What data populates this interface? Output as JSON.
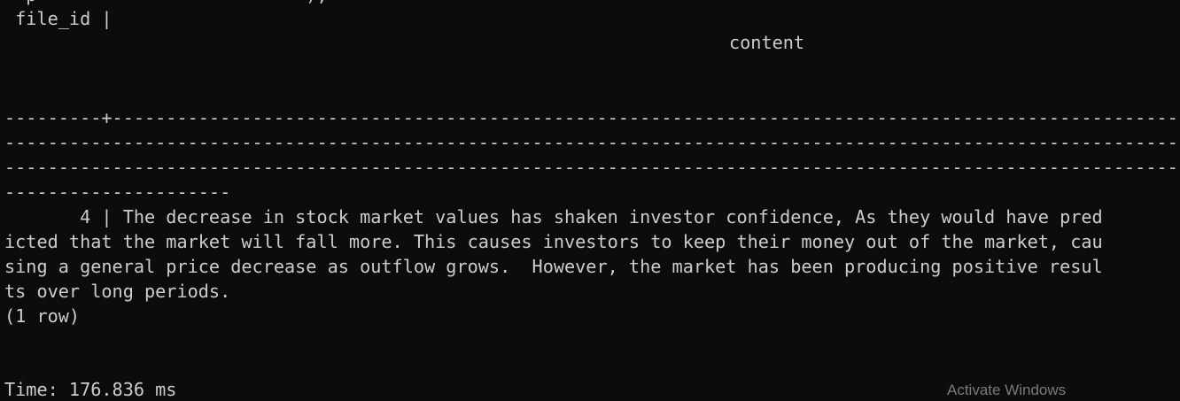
{
  "terminal": {
    "top_cut_line": "  p                         ),",
    "header_file_id": " file_id |",
    "header_content": "content",
    "separator_lines": [
      "---------+------------------------------------------------------------------------------------------------------------------------",
      "----------------------------------------------------------------------------------------------------------------------------------",
      "----------------------------------------------------------------------------------------------------------------------------------",
      "---------------------"
    ],
    "row_lines": [
      "       4 | The decrease in stock market values has shaken investor confidence, As they would have pred",
      "icted that the market will fall more. This causes investors to keep their money out of the market, cau",
      "sing a general price decrease as outflow grows.  However, the market has been producing positive resul",
      "ts over long periods."
    ],
    "row_count": "(1 row)",
    "timing": "Time: 176.836 ms"
  },
  "watermark": {
    "text": "Activate Windows"
  }
}
